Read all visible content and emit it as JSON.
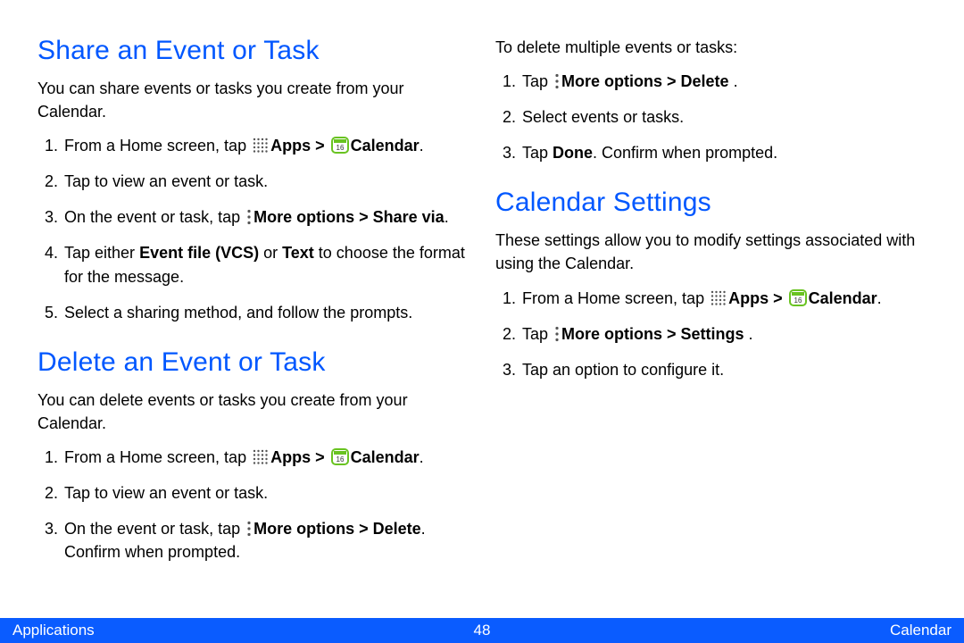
{
  "sections": {
    "share": {
      "title": "Share an Event or Task",
      "lead": "You can share events or tasks you create from your Calendar.",
      "steps": {
        "s1": {
          "a": "From a Home screen, tap ",
          "b": "Apps > ",
          "c": "Calendar",
          "d": "."
        },
        "s2": "Tap to view an event or task.",
        "s3": {
          "a": "On the event or task, tap ",
          "b": "More options > Share via",
          "c": "."
        },
        "s4": {
          "a": "Tap either ",
          "b": "Event file (VCS)",
          "c": " or ",
          "d": "Text",
          "e": " to choose the format for the message."
        },
        "s5": "Select a sharing method, and follow the prompts."
      }
    },
    "delete": {
      "title": "Delete an Event or Task",
      "lead": "You can delete events or tasks you create from your Calendar.",
      "steps": {
        "s1": {
          "a": "From a Home screen, tap ",
          "b": "Apps > ",
          "c": "Calendar",
          "d": "."
        },
        "s2": "Tap to view an event or task.",
        "s3": {
          "a": "On the event or task, tap ",
          "b": "More options > Delete",
          "c": ". Confirm when prompted."
        }
      }
    },
    "delete_multi": {
      "lead": "To delete multiple events or tasks:",
      "steps": {
        "s1": {
          "a": "Tap ",
          "b": "More options > Delete ",
          "c": "."
        },
        "s2": "Select events or tasks.",
        "s3": {
          "a": "Tap ",
          "b": "Done",
          "c": ". Confirm when prompted."
        }
      }
    },
    "settings": {
      "title": "Calendar Settings",
      "lead": "These settings allow you to modify settings associated with using the Calendar.",
      "steps": {
        "s1": {
          "a": "From a Home screen, tap ",
          "b": "Apps > ",
          "c": "Calendar",
          "d": "."
        },
        "s2": {
          "a": "Tap ",
          "b": "More options > Settings ",
          "c": "."
        },
        "s3": "Tap an option to configure it."
      }
    }
  },
  "footer": {
    "left": "Applications",
    "center": "48",
    "right": "Calendar"
  }
}
